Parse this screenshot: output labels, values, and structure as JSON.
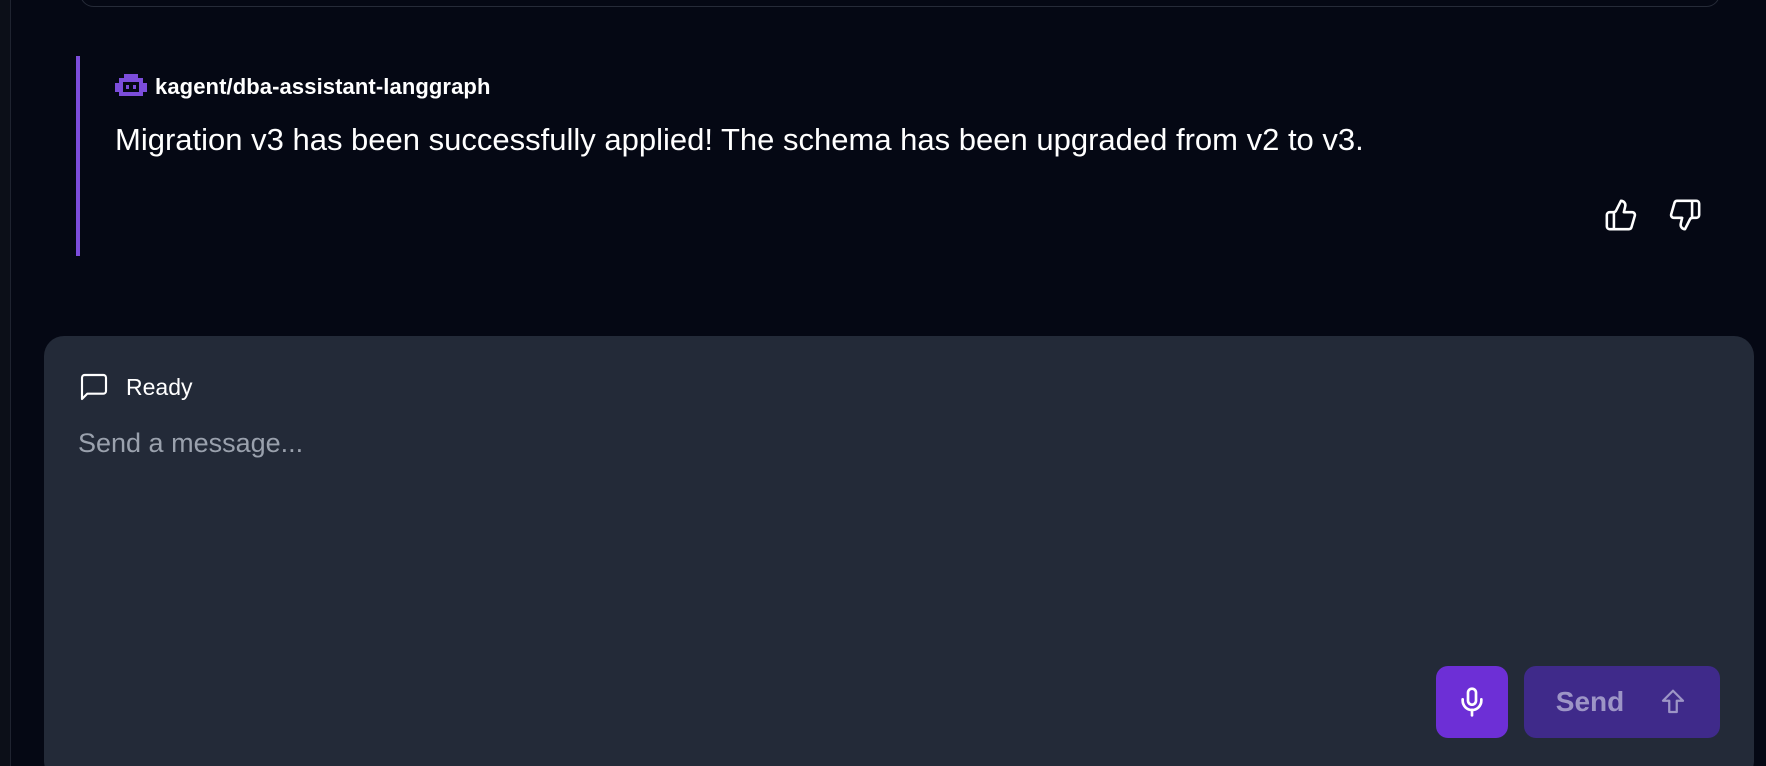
{
  "message": {
    "agent_name": "kagent/dba-assistant-langgraph",
    "text": "Migration v3 has been successfully applied! The schema has been upgraded from v2 to v3.",
    "icons": {
      "agent": "robot-icon",
      "like": "thumbs-up-icon",
      "dislike": "thumbs-down-icon"
    }
  },
  "composer": {
    "status": "Ready",
    "status_icon": "message-square-icon",
    "placeholder": "Send a message...",
    "mic_icon": "microphone-icon",
    "send_label": "Send",
    "send_icon": "arrow-up-icon"
  },
  "colors": {
    "background": "#050814",
    "accent": "#7c4ddb",
    "mic_button": "#6d2fd6",
    "send_button": "#3f2a8a",
    "composer": "#232a38"
  }
}
